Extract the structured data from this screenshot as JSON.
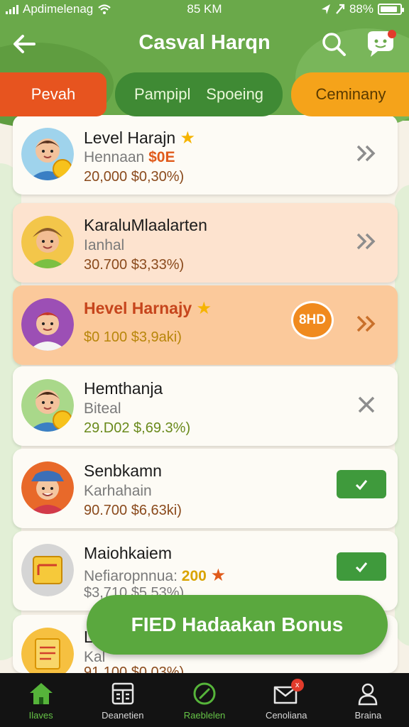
{
  "status": {
    "carrier": "Apdimelenag",
    "time": "85 KM",
    "battery": "88%",
    "battery_level": 0.88
  },
  "header": {
    "title": "Casval Harqn",
    "icons": [
      "back-arrow-icon",
      "search-icon",
      "chat-bubble-icon"
    ]
  },
  "tabs": [
    {
      "label": "Pevah"
    },
    {
      "label": "Pampipl"
    },
    {
      "label": "Spoeing"
    },
    {
      "label": "Ceminany"
    }
  ],
  "rows": [
    {
      "name": "Level Harajn",
      "sub_prefix": "Hennaan",
      "sub_highlight": "$0E",
      "value": "20,000 $0,30%)",
      "action": "chevron"
    },
    {
      "name": "KaraluMlaalarten",
      "sub": "Ianhal",
      "value": "30.700 $3,33%)",
      "action": "chevron"
    },
    {
      "name": "Hevel Harnajy",
      "bubble": "8HD",
      "value": "$0 100 $3,9aki)",
      "action": "chevron"
    },
    {
      "name": "Hemthanja",
      "sub": "Biteal",
      "value": "29.D02 $,69.3%)",
      "action": "close"
    },
    {
      "name": "Senbkamn",
      "sub": "Karhahain",
      "value": "90.700 $6,63ki)",
      "action": "go"
    },
    {
      "name": "Maiohkaiem",
      "sub_prefix": "Nefiaropnnua:",
      "sub_highlight": "200",
      "value": "$3,710 $5.53%)",
      "action": "go"
    },
    {
      "name": "L",
      "sub": "Kal",
      "value": "91.100 $0.03%)",
      "action": "none"
    }
  ],
  "cta": {
    "label": "FIED Hadaakan Bonus"
  },
  "nav": [
    {
      "label": "Ilaves",
      "icon": "home-icon"
    },
    {
      "label": "Deanetien",
      "icon": "calendar-icon"
    },
    {
      "label": "Raeblelen",
      "icon": "compass-icon"
    },
    {
      "label": "Cenoliana",
      "icon": "mail-icon",
      "badge": "x"
    },
    {
      "label": "Braina",
      "icon": "profile-icon"
    }
  ],
  "colors": {
    "header_green": "#6aa94a",
    "tab_red": "#e7541f",
    "tab_green": "#3f8a34",
    "tab_orange": "#f5a31a",
    "cta_green": "#5aa83e",
    "nav_active": "#66c447"
  }
}
